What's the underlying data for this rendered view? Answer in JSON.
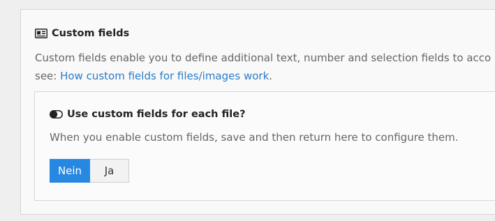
{
  "section": {
    "title": "Custom fields",
    "icon": "id-card-icon",
    "description_line1": "Custom fields enable you to define additional text, number and selection fields to acco",
    "description_line2_prefix": "see: ",
    "description_link": "How custom fields for files/images work",
    "description_line2_suffix": "."
  },
  "setting": {
    "title": "Use custom fields for each file?",
    "icon": "toggle-icon",
    "hint": "When you enable custom fields, save and then return here to configure them.",
    "options": [
      {
        "label": "Nein",
        "selected": true
      },
      {
        "label": "Ja",
        "selected": false
      }
    ]
  },
  "colors": {
    "accent": "#2788e2",
    "link": "#2a7cc8"
  }
}
